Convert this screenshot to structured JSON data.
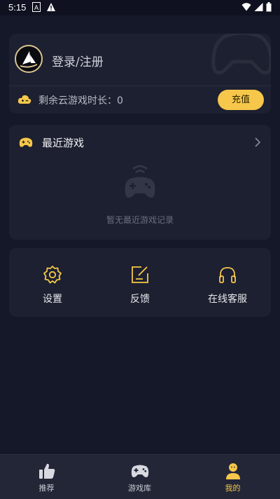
{
  "status_bar": {
    "time": "5:15"
  },
  "profile": {
    "login_label": "登录/注册"
  },
  "cloud": {
    "remaining_label": "剩余云游戏时长：0",
    "recharge_label": "充值"
  },
  "recent": {
    "title": "最近游戏",
    "empty_text": "暂无最近游戏记录"
  },
  "tools": [
    {
      "label": "设置",
      "icon": "gear-icon"
    },
    {
      "label": "反馈",
      "icon": "feedback-edit-icon"
    },
    {
      "label": "在线客服",
      "icon": "headset-icon"
    }
  ],
  "tabs": [
    {
      "label": "推荐",
      "icon": "thumbs-up-icon",
      "active": false
    },
    {
      "label": "游戏库",
      "icon": "gamepad-icon",
      "active": false
    },
    {
      "label": "我的",
      "icon": "user-icon",
      "active": true
    }
  ],
  "colors": {
    "background": "#151828",
    "card": "#1d2030",
    "accent": "#f6c74a",
    "tab_bar": "#232636"
  }
}
